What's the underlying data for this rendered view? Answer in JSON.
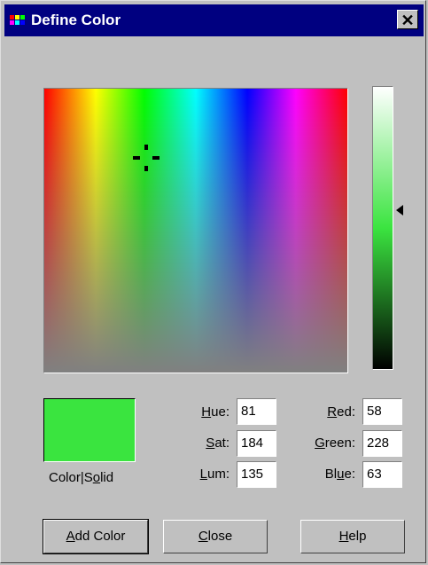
{
  "window": {
    "title": "Define Color",
    "close_glyph": "✕"
  },
  "spectrum": {
    "hue": 81,
    "sat": 184
  },
  "luminance": {
    "level": 135
  },
  "swatch": {
    "color": "#3ae43f",
    "label_pre": "Color|S",
    "label_u": "o",
    "label_post": "lid"
  },
  "fields": {
    "hue": {
      "label_u": "H",
      "label_rest": "ue:",
      "value": "81"
    },
    "sat": {
      "label_u": "S",
      "label_rest": "at:",
      "value": "184"
    },
    "lum": {
      "label_u": "L",
      "label_rest": "um:",
      "value": "135"
    },
    "red": {
      "label_u": "R",
      "label_rest": "ed:",
      "value": "58"
    },
    "green": {
      "label_u": "G",
      "label_rest": "reen:",
      "value": "228"
    },
    "blue": {
      "label_pre": "Bl",
      "label_u": "u",
      "label_rest": "e:",
      "value": "63"
    }
  },
  "buttons": {
    "add_color": {
      "u": "A",
      "rest": "dd Color"
    },
    "close": {
      "u": "C",
      "rest": "lose"
    },
    "help": {
      "u": "H",
      "rest": "elp"
    }
  },
  "colors": {
    "titlebar": "#000080",
    "face": "#c0c0c0",
    "selected": "#3ae43f"
  },
  "icons": {
    "app": "color-palette-icon",
    "close": "close-icon",
    "crosshair": "crosshair-icon",
    "lum_pointer": "triangle-left-icon"
  }
}
